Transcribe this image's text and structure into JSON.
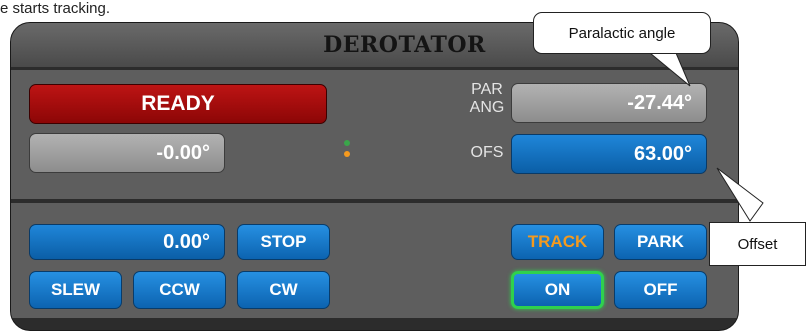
{
  "doc": {
    "text": "e starts tracking."
  },
  "panel": {
    "title": "DEROTATOR",
    "status": "READY",
    "position": "-0.00°",
    "par_label_line1": "PAR",
    "par_label_line2": "ANG",
    "par_value": "-27.44°",
    "ofs_label": "OFS",
    "ofs_value": "63.00°",
    "target_value": "0.00°",
    "buttons": {
      "stop": "STOP",
      "slew": "SLEW",
      "ccw": "CCW",
      "cw": "CW",
      "track": "TRACK",
      "park": "PARK",
      "on": "ON",
      "off": "OFF"
    },
    "indicators": {
      "upper": "#3aa64a",
      "lower": "#f59a1e"
    }
  },
  "callouts": {
    "paralactic": "Paralactic angle",
    "offset": "Offset"
  }
}
